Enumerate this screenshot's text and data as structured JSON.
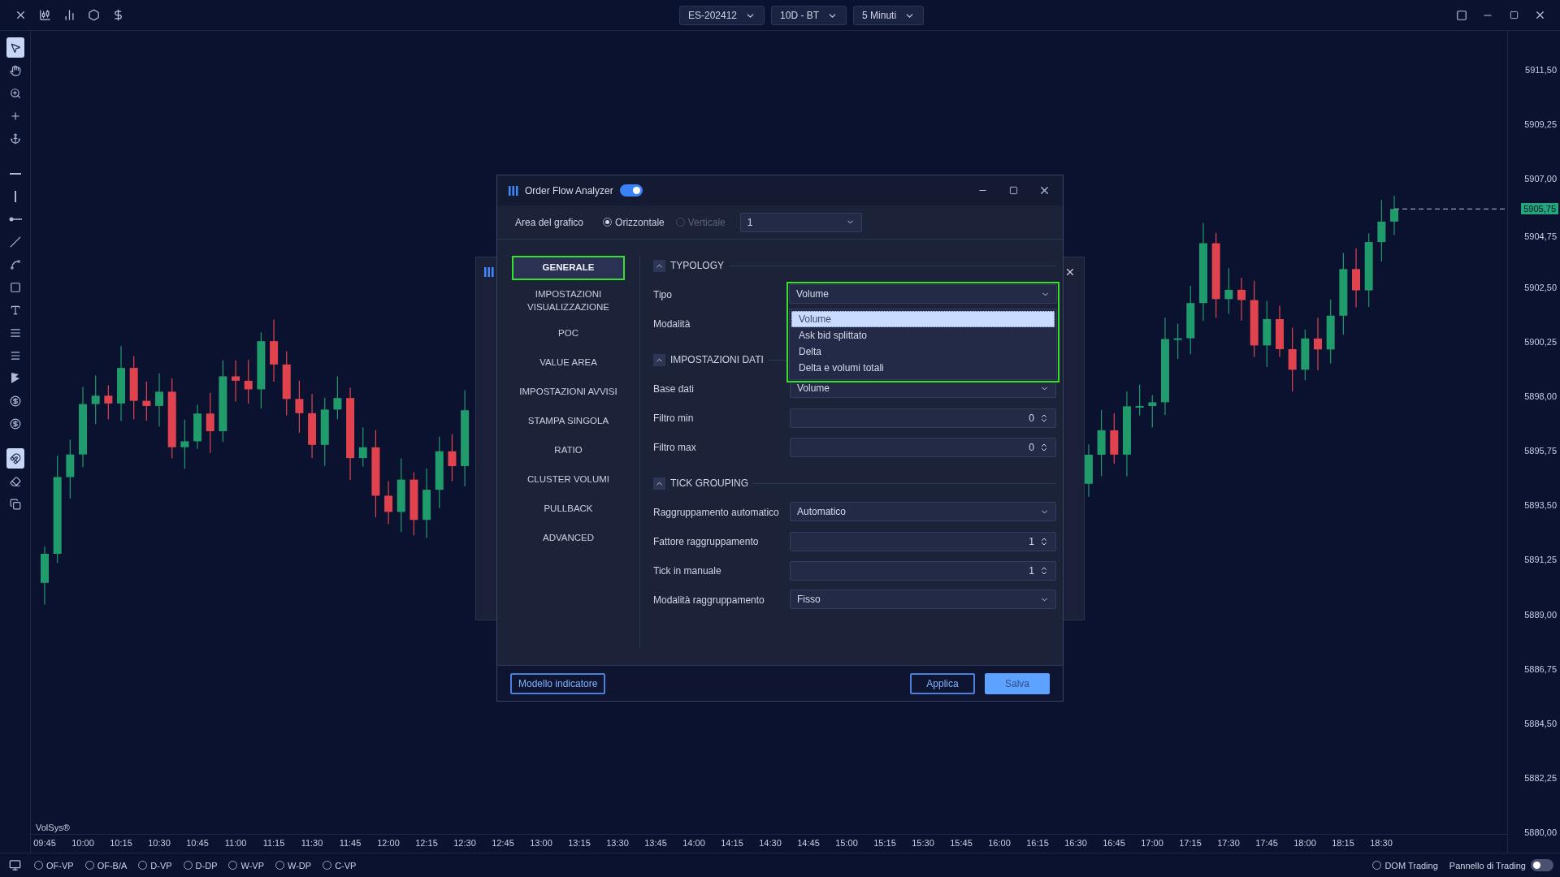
{
  "top_bar": {
    "selectors": [
      "ES-202412",
      "10D - BT",
      "5 Minuti"
    ]
  },
  "left_toolbar": {
    "groups": [
      [
        {
          "selected": true
        },
        {
          "selected": false
        },
        {
          "selected": false
        },
        {
          "selected": false
        },
        {
          "selected": false
        }
      ],
      [
        {
          "selected": false
        },
        {
          "selected": false
        },
        {
          "selected": false
        },
        {
          "selected": false
        },
        {
          "selected": false
        },
        {
          "selected": false
        },
        {
          "selected": false
        },
        {
          "selected": false
        },
        {
          "selected": false
        },
        {
          "selected": false
        },
        {
          "selected": false
        },
        {
          "selected": false
        }
      ],
      [
        {
          "selected": true
        },
        {
          "selected": false
        },
        {
          "selected": false
        }
      ]
    ]
  },
  "chart": {
    "label": "VolSys®",
    "last_price": "5905,75",
    "price_labels": [
      "5911,50",
      "5909,25",
      "5907,00",
      "5904,75",
      "5902,50",
      "5900,25",
      "5898,00",
      "5895,75",
      "5893,50",
      "5891,25",
      "5889,00",
      "5886,75",
      "5884,50",
      "5882,25",
      "5880,00"
    ],
    "time_labels": [
      "09:45",
      "10:00",
      "10:15",
      "10:30",
      "10:45",
      "11:00",
      "11:15",
      "11:30",
      "11:45",
      "12:00",
      "12:15",
      "12:30",
      "12:45",
      "13:00",
      "13:15",
      "13:30",
      "13:45",
      "14:00",
      "14:15",
      "14:30",
      "14:45",
      "15:00",
      "15:15",
      "15:30",
      "15:45",
      "16:00",
      "16:15",
      "16:30",
      "16:45",
      "17:00",
      "17:15",
      "17:30",
      "17:45",
      "18:00",
      "18:15",
      "18:30"
    ]
  },
  "dialog": {
    "title": "Order Flow Analyzer",
    "enabled": true,
    "chart_area": {
      "label": "Area del grafico",
      "options": [
        {
          "label": "Orizzontale",
          "selected": true,
          "disabled": false
        },
        {
          "label": "Verticale",
          "selected": false,
          "disabled": true
        }
      ],
      "value": "1"
    },
    "nav": [
      {
        "label": "GENERALE",
        "selected": true,
        "highlighted": true
      },
      {
        "label": "IMPOSTAZIONI VISUALIZZAZIONE",
        "selected": false,
        "highlighted": false
      },
      {
        "label": "POC",
        "selected": false,
        "highlighted": false
      },
      {
        "label": "VALUE AREA",
        "selected": false,
        "highlighted": false
      },
      {
        "label": "IMPOSTAZIONI AVVISI",
        "selected": false,
        "highlighted": false
      },
      {
        "label": "STAMPA SINGOLA",
        "selected": false,
        "highlighted": false
      },
      {
        "label": "RATIO",
        "selected": false,
        "highlighted": false
      },
      {
        "label": "CLUSTER VOLUMI",
        "selected": false,
        "highlighted": false
      },
      {
        "label": "PULLBACK",
        "selected": false,
        "highlighted": false
      },
      {
        "label": "ADVANCED",
        "selected": false,
        "highlighted": false
      }
    ],
    "sections": [
      {
        "title": "TYPOLOGY",
        "expanded": true,
        "fields": [
          {
            "label": "Tipo",
            "kind": "select",
            "value": "Volume",
            "highlighted": true,
            "options": [
              {
                "label": "Volume",
                "selected": true
              },
              {
                "label": "Ask bid splittato",
                "selected": false
              },
              {
                "label": "Delta",
                "selected": false
              },
              {
                "label": "Delta e volumi totali",
                "selected": false
              }
            ]
          },
          {
            "label": "Modalità",
            "kind": "covered"
          }
        ]
      },
      {
        "title": "IMPOSTAZIONI DATI",
        "expanded": true,
        "fields": [
          {
            "label": "Base dati",
            "kind": "select",
            "value": "Volume"
          },
          {
            "label": "Filtro min",
            "kind": "number",
            "value": "0"
          },
          {
            "label": "Filtro max",
            "kind": "number",
            "value": "0"
          }
        ]
      },
      {
        "title": "TICK GROUPING",
        "expanded": true,
        "fields": [
          {
            "label": "Raggruppamento automatico",
            "kind": "select",
            "value": "Automatico"
          },
          {
            "label": "Fattore raggruppamento",
            "kind": "number",
            "value": "1"
          },
          {
            "label": "Tick in manuale",
            "kind": "number",
            "value": "1"
          },
          {
            "label": "Modalità raggruppamento",
            "kind": "select",
            "value": "Fisso"
          }
        ]
      }
    ],
    "footer": {
      "template_button": "Modello indicatore",
      "buttons": [
        {
          "label": "Applica",
          "kind": "secondary"
        },
        {
          "label": "Salva",
          "kind": "primary"
        }
      ]
    }
  },
  "bottom_bar": {
    "indicators": [
      {
        "label": "OF-VP",
        "selected": false
      },
      {
        "label": "OF-B/A",
        "selected": false
      },
      {
        "label": "D-VP",
        "selected": false
      },
      {
        "label": "D-DP",
        "selected": false
      },
      {
        "label": "W-VP",
        "selected": false
      },
      {
        "label": "W-DP",
        "selected": false
      },
      {
        "label": "C-VP",
        "selected": false
      }
    ],
    "dom_trading": {
      "label": "DOM Trading",
      "selected": false
    },
    "trading_panel": {
      "label": "Pannello di Trading",
      "on": false
    }
  }
}
